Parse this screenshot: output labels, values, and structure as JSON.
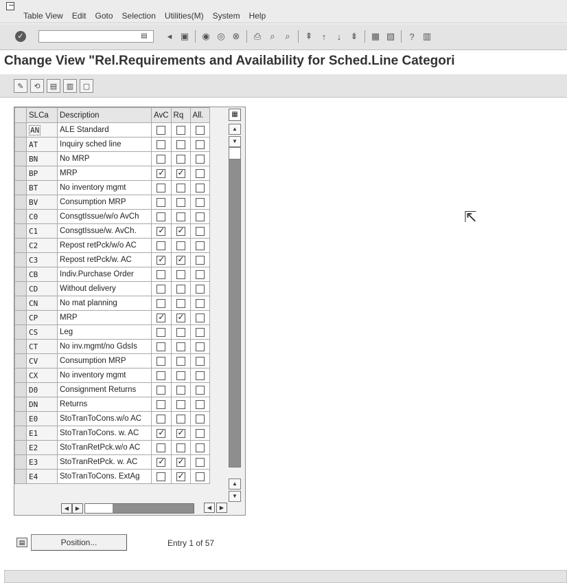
{
  "menu": {
    "items": [
      "Table View",
      "Edit",
      "Goto",
      "Selection",
      "Utilities(M)",
      "System",
      "Help"
    ]
  },
  "toolbar": {
    "command_value": "",
    "icons": [
      "enter-icon",
      "save-icon",
      "back-icon",
      "exit-icon",
      "cancel-icon",
      "print-icon",
      "find-icon",
      "find-next-icon",
      "first-page-icon",
      "previous-page-icon",
      "next-page-icon",
      "last-page-icon",
      "create-session-icon",
      "shortcut-icon",
      "help-icon",
      "layout-menu-icon"
    ]
  },
  "page": {
    "title": "Change View \"Rel.Requirements and Availability for Sched.Line Categori"
  },
  "app_toolbar": {
    "icons": [
      "display-change-icon",
      "other-entry-icon",
      "select-all-icon",
      "select-block-icon",
      "deselect-all-icon"
    ]
  },
  "table": {
    "headers": [
      "SLCa",
      "Description",
      "AvC",
      "Rq",
      "All."
    ],
    "rows": [
      {
        "code": "AN",
        "desc": "ALE Standard",
        "avc": false,
        "rq": false,
        "all": false
      },
      {
        "code": "AT",
        "desc": "Inquiry sched line",
        "avc": false,
        "rq": false,
        "all": false
      },
      {
        "code": "BN",
        "desc": "No MRP",
        "avc": false,
        "rq": false,
        "all": false
      },
      {
        "code": "BP",
        "desc": "MRP",
        "avc": true,
        "rq": true,
        "all": false
      },
      {
        "code": "BT",
        "desc": "No inventory mgmt",
        "avc": false,
        "rq": false,
        "all": false
      },
      {
        "code": "BV",
        "desc": "Consumption MRP",
        "avc": false,
        "rq": false,
        "all": false
      },
      {
        "code": "C0",
        "desc": "ConsgtIssue/w/o AvCh",
        "avc": false,
        "rq": false,
        "all": false
      },
      {
        "code": "C1",
        "desc": "ConsgtIssue/w. AvCh.",
        "avc": true,
        "rq": true,
        "all": false
      },
      {
        "code": "C2",
        "desc": "Repost retPck/w/o AC",
        "avc": false,
        "rq": false,
        "all": false
      },
      {
        "code": "C3",
        "desc": "Repost retPck/w. AC",
        "avc": true,
        "rq": true,
        "all": false
      },
      {
        "code": "CB",
        "desc": "Indiv.Purchase Order",
        "avc": false,
        "rq": false,
        "all": false
      },
      {
        "code": "CD",
        "desc": "Without delivery",
        "avc": false,
        "rq": false,
        "all": false
      },
      {
        "code": "CN",
        "desc": "No mat planning",
        "avc": false,
        "rq": false,
        "all": false
      },
      {
        "code": "CP",
        "desc": "MRP",
        "avc": true,
        "rq": true,
        "all": false
      },
      {
        "code": "CS",
        "desc": "Leg",
        "avc": false,
        "rq": false,
        "all": false
      },
      {
        "code": "CT",
        "desc": "No inv.mgmt/no GdsIs",
        "avc": false,
        "rq": false,
        "all": false
      },
      {
        "code": "CV",
        "desc": "Consumption MRP",
        "avc": false,
        "rq": false,
        "all": false
      },
      {
        "code": "CX",
        "desc": "No inventory mgmt",
        "avc": false,
        "rq": false,
        "all": false
      },
      {
        "code": "D0",
        "desc": "Consignment Returns",
        "avc": false,
        "rq": false,
        "all": false
      },
      {
        "code": "DN",
        "desc": "Returns",
        "avc": false,
        "rq": false,
        "all": false
      },
      {
        "code": "E0",
        "desc": "StoTranToCons.w/o AC",
        "avc": false,
        "rq": false,
        "all": false
      },
      {
        "code": "E1",
        "desc": "StoTranToCons. w. AC",
        "avc": true,
        "rq": true,
        "all": false
      },
      {
        "code": "E2",
        "desc": "StoTranRetPck.w/o AC",
        "avc": false,
        "rq": false,
        "all": false
      },
      {
        "code": "E3",
        "desc": "StoTranRetPck. w. AC",
        "avc": true,
        "rq": true,
        "all": false
      },
      {
        "code": "E4",
        "desc": "StoTranToCons. ExtAg",
        "avc": false,
        "rq": true,
        "all": false
      }
    ]
  },
  "footer": {
    "position_button": "Position...",
    "entry_info": "Entry 1 of 57"
  }
}
